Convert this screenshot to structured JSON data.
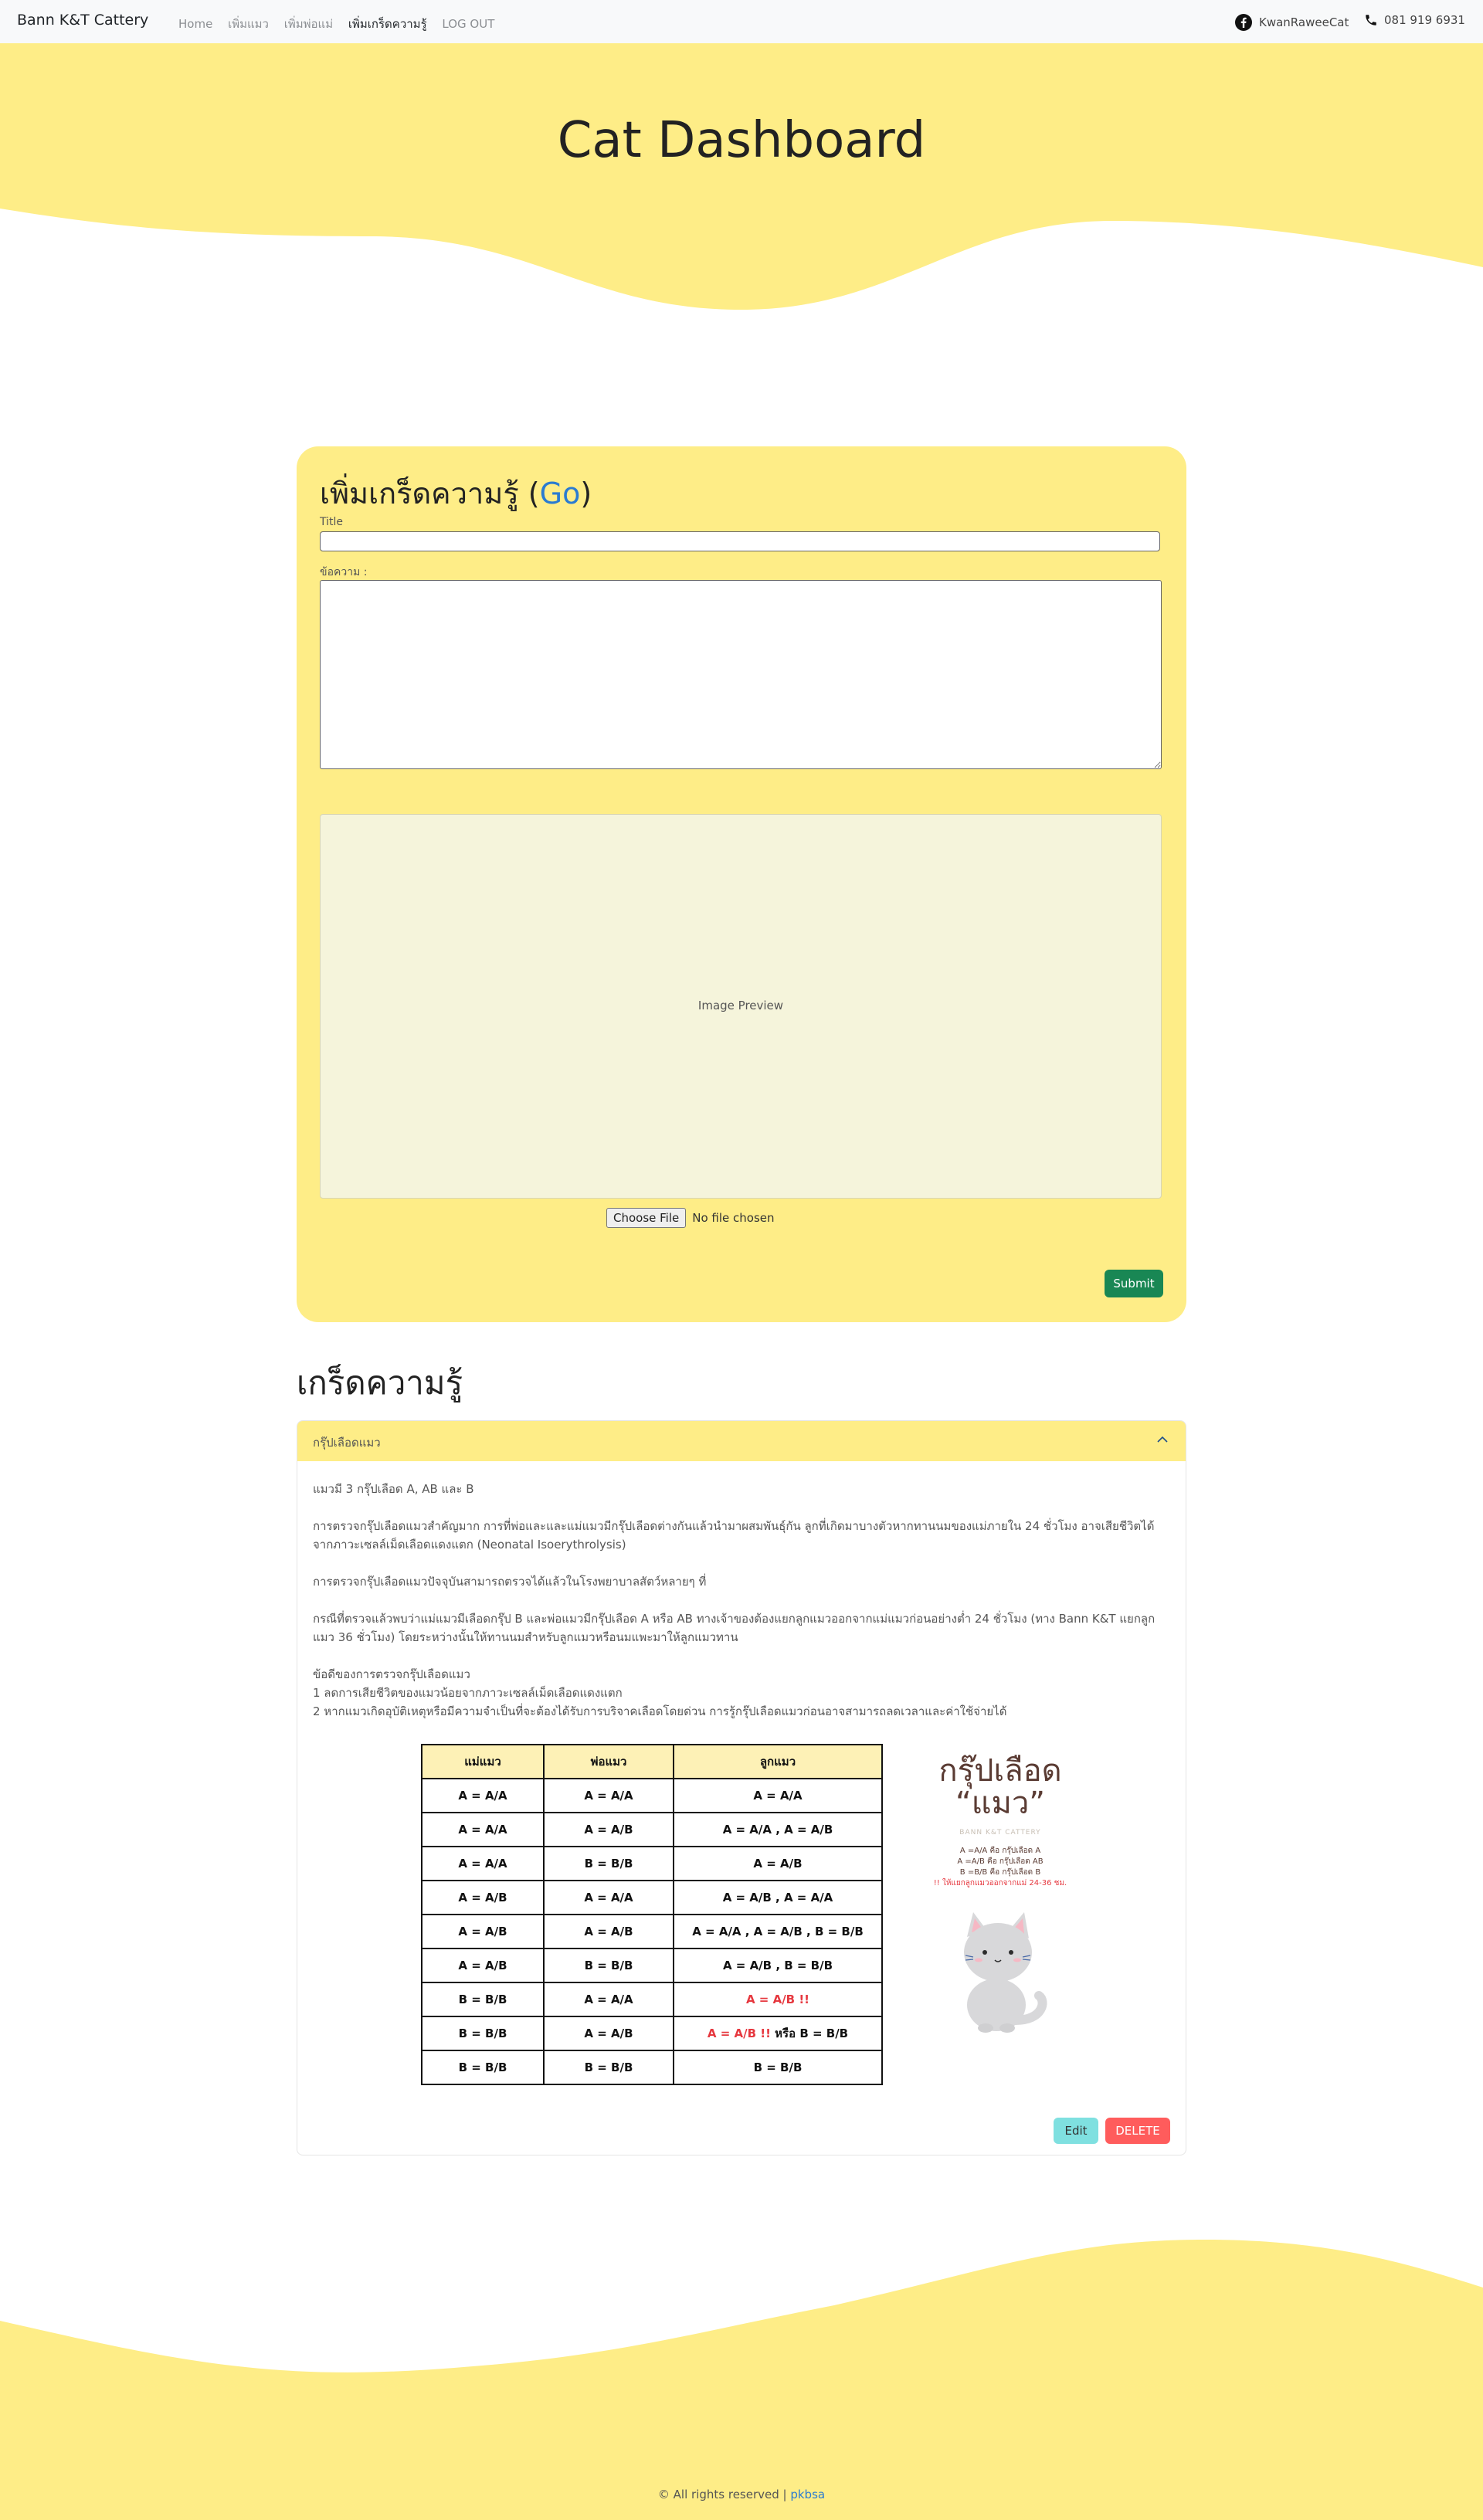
{
  "navbar": {
    "brand": "Bann K&T Cattery",
    "links": [
      "Home",
      "เพิ่มแมว",
      "เพิ่มพ่อแม่",
      "เพิ่มเกร็ดความรู้",
      "LOG OUT"
    ],
    "active_index": 3,
    "facebook": "KwanRaweeCat",
    "phone": "081 919 6931"
  },
  "hero": {
    "title": "Cat Dashboard"
  },
  "form": {
    "heading": "เพิ่มเกร็ดความรู้ (",
    "heading_link": "Go",
    "heading_end": ")",
    "title_label": "Title",
    "body_label": "ข้อความ :",
    "preview_label": "Image Preview",
    "choose_file": "Choose File",
    "no_file": "No file chosen",
    "submit": "Submit"
  },
  "knowledge": {
    "section_title": "เกร็ดความรู้",
    "item": {
      "header": "กรุ๊ปเลือดแมว",
      "p1": "แมวมี 3 กรุ๊ปเลือด A, AB และ B",
      "p2": "การตรวจกรุ๊ปเลือดแมวสำคัญมาก การที่พ่อและและแม่แมวมีกรุ๊ปเลือดต่างกันแล้วนำมาผสมพันธุ์กัน ลูกที่เกิดมาบางตัวหากทานนมของแม่ภายใน 24 ชั่วโมง อาจเสียชีวิตได้จากภาวะเซลล์เม็ดเลือดแดงแตก (Neonatal Isoerythrolysis)",
      "p3": "การตรวจกรุ๊ปเลือดแมวปัจจุบันสามารถตรวจได้แล้วในโรงพยาบาลสัตว์หลายๆ ที่",
      "p4": "กรณีที่ตรวจแล้วพบว่าแม่แมวมีเลือดกรุ๊ป B และพ่อแมวมีกรุ๊ปเลือด A หรือ AB ทางเจ้าของต้องแยกลูกแมวออกจากแม่แมวก่อนอย่างต่ำ 24 ชั่วโมง (ทาง Bann K&T แยกลูกแมว 36 ชั่วโมง) โดยระหว่างนั้นให้ทานนมสำหรับลูกแมวหรือนมแพะมาให้ลูกแมวทาน",
      "p5a": "ข้อดีของการตรวจกรุ๊ปเลือดแมว",
      "p5b": "1 ลดการเสียชีวิตของแมวน้อยจากภาวะเซลล์เม็ดเลือดแดงแตก",
      "p5c": "2 หากแมวเกิดอุบัติเหตุหรือมีความจำเป็นที่จะต้องได้รับการบริจาคเลือดโดยด่วน การรู้กรุ๊ปเลือดแมวก่อนอาจสามารถลดเวลาและค่าใช้จ่ายได้",
      "table": {
        "headers": [
          "แม่แมว",
          "พ่อแมว",
          "ลูกแมว"
        ],
        "rows": [
          [
            "A = A/A",
            "A = A/A",
            "A = A/A",
            ""
          ],
          [
            "A = A/A",
            "A = A/B",
            "A = A/A , A = A/B",
            ""
          ],
          [
            "A = A/A",
            "B = B/B",
            "A = A/B",
            ""
          ],
          [
            "A = A/B",
            "A = A/A",
            "A = A/B , A = A/A",
            ""
          ],
          [
            "A = A/B",
            "A = A/B",
            "A = A/A , A = A/B , B = B/B",
            ""
          ],
          [
            "A = A/B",
            "B = B/B",
            "A = A/B , B = B/B",
            ""
          ],
          [
            "B = B/B",
            "A = A/A",
            "",
            "A = A/B !!"
          ],
          [
            "B = B/B",
            "A = A/B",
            "B = B/B",
            "A = A/B !!"
          ],
          [
            "B = B/B",
            "B = B/B",
            "B = B/B",
            ""
          ]
        ],
        "r8_joiner": "หรือ"
      },
      "infographic": {
        "title_line1": "กรุ๊ปเลือด",
        "title_line2": "“แมว”",
        "subtitle": "BANN K&T CATTERY",
        "line1": "A =A/A คือ กรุ๊ปเลือด A",
        "line2": "A =A/B คือ กรุ๊ปเลือด AB",
        "line3": "B =B/B คือ กรุ๊ปเลือด B",
        "warning": "!! ให้แยกลูกแมวออกจากแม่ 24-36 ชม."
      },
      "edit": "Edit",
      "delete": "DELETE"
    }
  },
  "footer": {
    "copyright": "© All rights reserved | ",
    "link": "pkbsa"
  },
  "colors": {
    "yellow": "#feed87",
    "submit": "#198754",
    "edit": "#7fe0e0",
    "delete": "#ff5c5c",
    "link": "#2a7bd1"
  },
  "icons": {
    "facebook": "facebook-icon",
    "phone": "phone-icon",
    "chevron": "chevron-up-icon"
  }
}
